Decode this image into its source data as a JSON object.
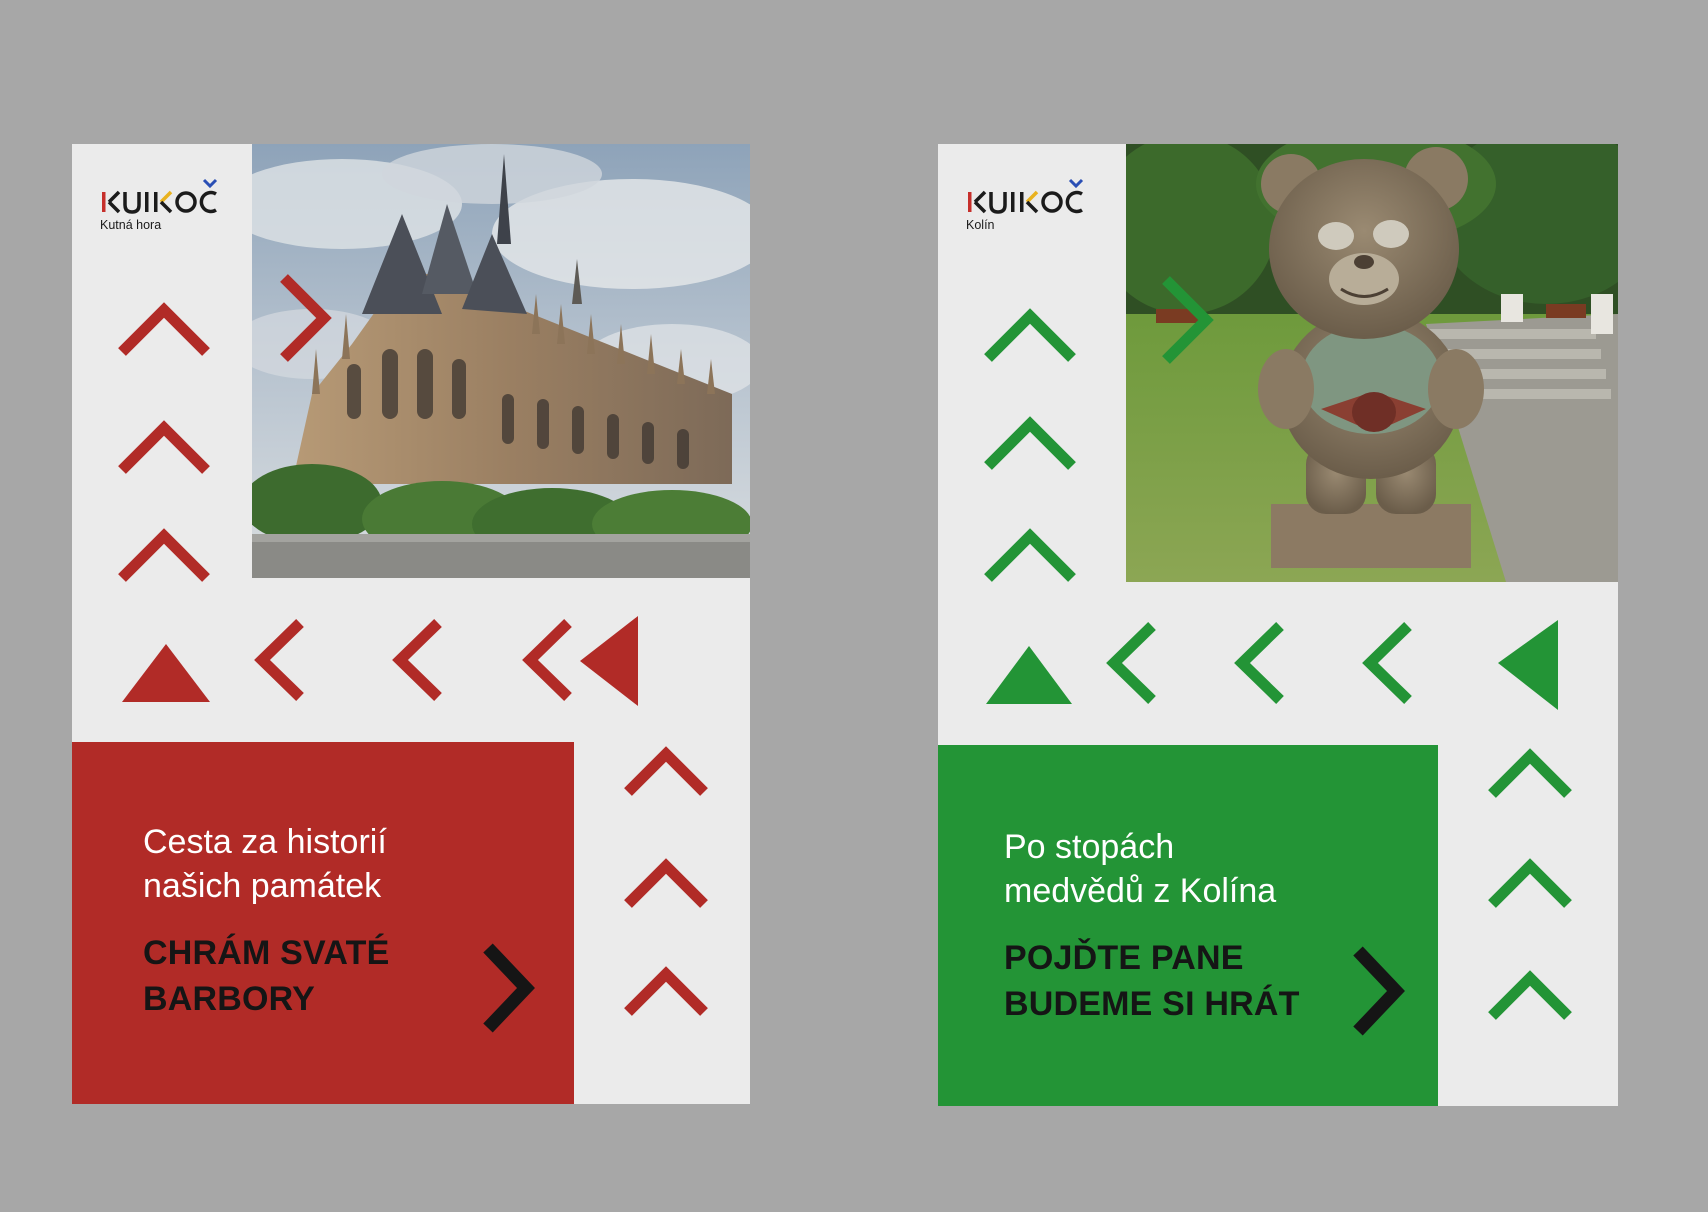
{
  "posters": [
    {
      "logo_text": "KUKOČ",
      "logo_subtitle": "Kutná hora",
      "subtitle": "Cesta za historií\nnašich památek",
      "headline": "CHRÁM SVATÉ\nBARBORY",
      "accent_color": "#b12b27",
      "photo_subject": "gothic cathedral"
    },
    {
      "logo_text": "KUKOČ",
      "logo_subtitle": "Kolín",
      "subtitle": "Po stopách\nmedvědů z Kolína",
      "headline": "POJĎTE PANE\nBUDEME SI HRÁT",
      "accent_color": "#239436",
      "photo_subject": "wooden bear statue"
    }
  ]
}
